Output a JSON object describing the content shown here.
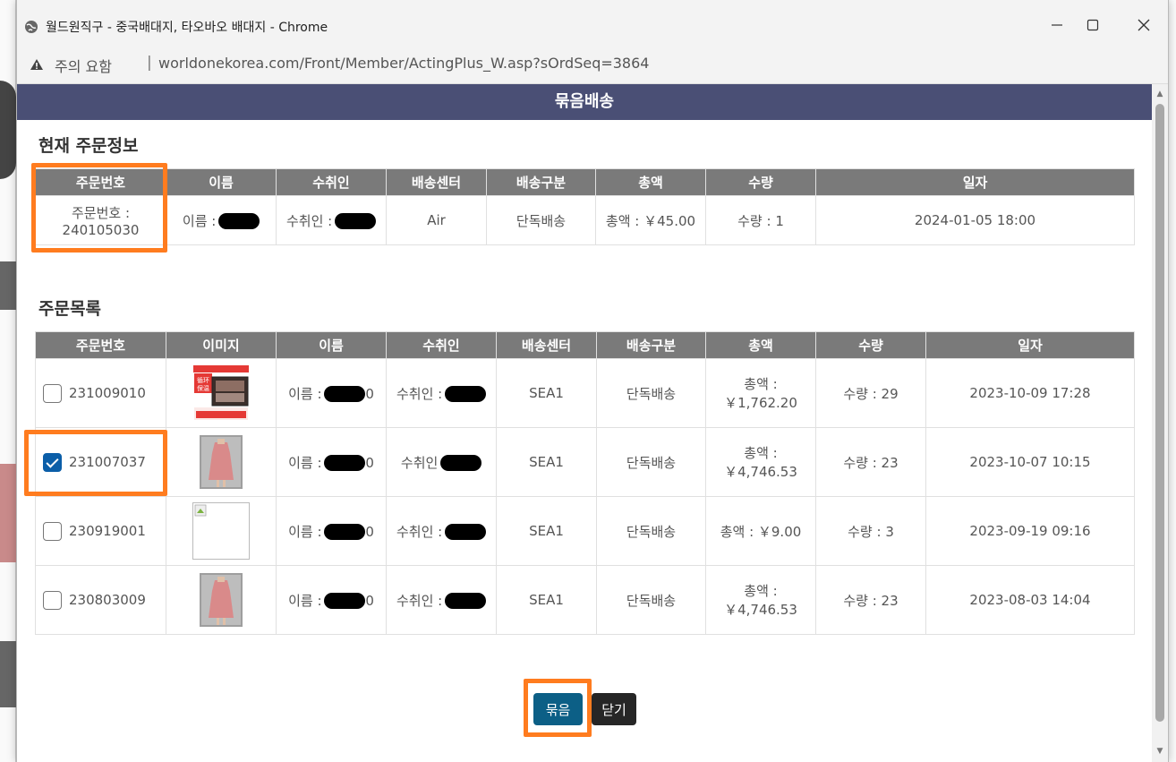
{
  "window": {
    "title": "월드원직구 - 중국배대지, 타오바오 배대지 - Chrome",
    "warning_text": "주의 요함",
    "url": "worldonekorea.com/Front/Member/ActingPlus_W.asp?sOrdSeq=3864"
  },
  "header": {
    "title": "묶음배송"
  },
  "current": {
    "section_title": "현재 주문정보",
    "columns": [
      "주문번호",
      "이름",
      "수취인",
      "배송센터",
      "배송구분",
      "총액",
      "수량",
      "일자"
    ],
    "row": {
      "order_label": "주문번호 :",
      "order_no": "240105030",
      "name": "이름 :",
      "receiver": "수취인 :",
      "center": "Air",
      "type": "단독배송",
      "total": "총액 : ￥45.00",
      "qty": "수량 : 1",
      "date": "2024-01-05 18:00"
    }
  },
  "orders": {
    "section_title": "주문목록",
    "columns": [
      "주문번호",
      "이미지",
      "이름",
      "수취인",
      "배송센터",
      "배송구분",
      "총액",
      "수량",
      "일자"
    ],
    "rows": [
      {
        "order_no": "231009010",
        "checked": false,
        "image": "product-heater",
        "name": "이름 :",
        "name_tail": "0",
        "receiver": "수취인 :",
        "center": "SEA1",
        "type": "단독배송",
        "total_label": "총액 :",
        "total_value": "￥1,762.20",
        "qty": "수량 : 29",
        "date": "2023-10-09 17:28"
      },
      {
        "order_no": "231007037",
        "checked": true,
        "image": "product-dress",
        "name": "이름 :",
        "name_tail": "0",
        "receiver": "수취인",
        "center": "SEA1",
        "type": "단독배송",
        "total_label": "총액 :",
        "total_value": "￥4,746.53",
        "qty": "수량 : 23",
        "date": "2023-10-07 10:15"
      },
      {
        "order_no": "230919001",
        "checked": false,
        "image": "broken-image",
        "name": "이름 :",
        "name_tail": "0",
        "receiver": "수취인 :",
        "center": "SEA1",
        "type": "단독배송",
        "total_label": "총액 : ￥9.00",
        "total_value": "",
        "qty": "수량 : 3",
        "date": "2023-09-19 09:16"
      },
      {
        "order_no": "230803009",
        "checked": false,
        "image": "product-dress",
        "name": "이름 :",
        "name_tail": "0",
        "receiver": "수취인 :",
        "center": "SEA1",
        "type": "단독배송",
        "total_label": "총액 :",
        "total_value": "￥4,746.53",
        "qty": "수량 : 23",
        "date": "2023-08-03 14:04"
      }
    ]
  },
  "buttons": {
    "bundle": "묶음",
    "close": "닫기"
  },
  "colors": {
    "header": "#4a4f75",
    "table_head": "#7a7a7a",
    "highlight": "#ff7c1f",
    "bundle_btn": "#0c5f86",
    "close_btn": "#262626"
  }
}
